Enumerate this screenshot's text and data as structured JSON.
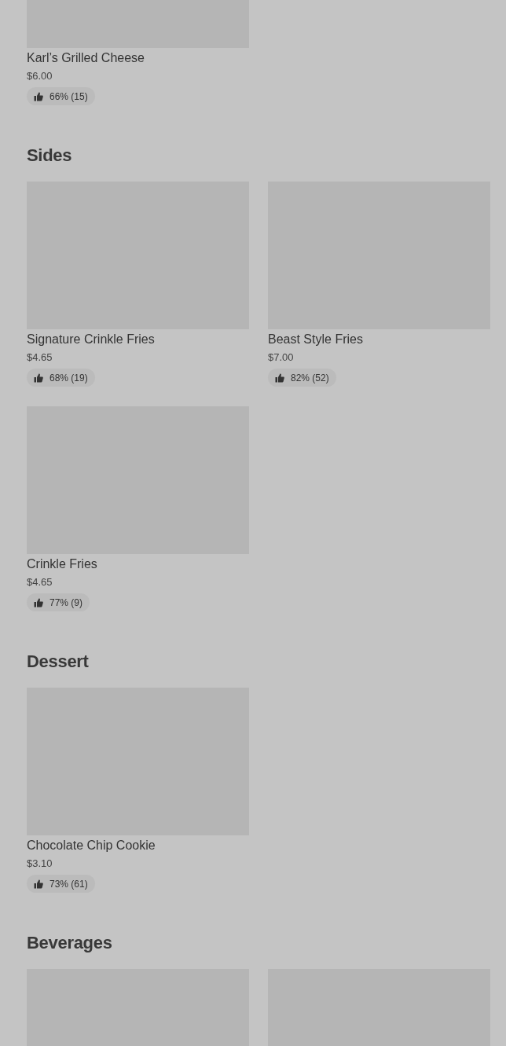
{
  "sections": [
    {
      "items": [
        {
          "name": "Karl’s Grilled Cheese",
          "price": "$6.00",
          "rating": "66% (15)"
        }
      ]
    },
    {
      "title": "Sides",
      "items": [
        {
          "name": "Signature Crinkle Fries",
          "price": "$4.65",
          "rating": "68% (19)"
        },
        {
          "name": "Beast Style Fries",
          "price": "$7.00",
          "rating": "82% (52)"
        },
        {
          "name": "Crinkle Fries",
          "price": "$4.65",
          "rating": "77% (9)"
        }
      ]
    },
    {
      "title": "Dessert",
      "items": [
        {
          "name": "Chocolate Chip Cookie",
          "price": "$3.10",
          "rating": "73% (61)"
        }
      ]
    },
    {
      "title": "Beverages"
    }
  ]
}
